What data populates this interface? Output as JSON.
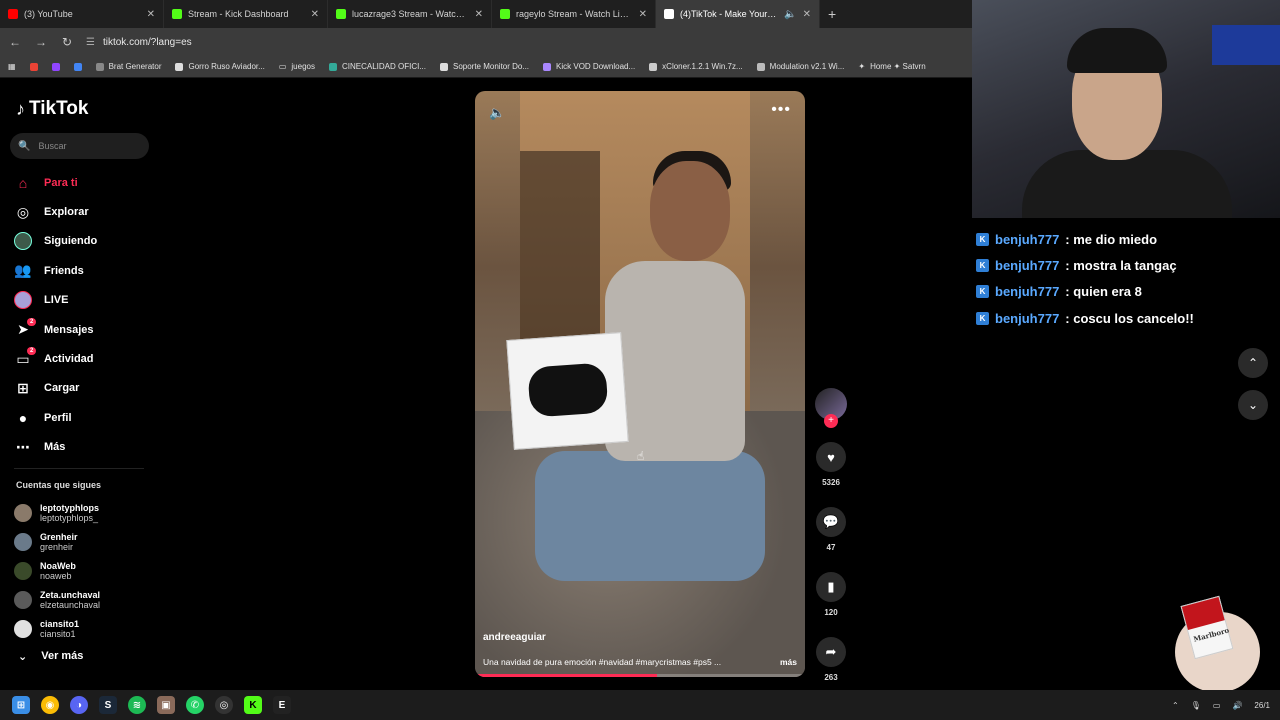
{
  "browser": {
    "tabs": [
      {
        "title": "(3) YouTube",
        "color": "#ff0000"
      },
      {
        "title": "Stream - Kick Dashboard",
        "color": "#53fc18"
      },
      {
        "title": "lucazrage3 Stream - Watch Live on",
        "color": "#53fc18"
      },
      {
        "title": "rageylo Stream - Watch Live on",
        "color": "#53fc18"
      },
      {
        "title": "(4)TikTok - Make Your Day",
        "color": "#ffffff"
      }
    ],
    "new_tab": "+",
    "url": "tiktok.com/?lang=es",
    "bookmarks": [
      "Brat Generator",
      "Gorro Ruso Aviador...",
      "juegos",
      "CINECALIDAD OFICI...",
      "Soporte Monitor Do...",
      "Kick VOD Download...",
      "xCloner.1.2.1 Win.7z...",
      "Modulation v2.1 Wi...",
      "Home ✦ Satvrn"
    ]
  },
  "tiktok": {
    "logo": "TikTok",
    "search_placeholder": "Buscar",
    "nav": [
      {
        "label": "Para ti",
        "icon": "home-icon",
        "active": true
      },
      {
        "label": "Explorar",
        "icon": "compass-icon"
      },
      {
        "label": "Siguiendo",
        "icon": "following-avatar-icon"
      },
      {
        "label": "Friends",
        "icon": "friends-icon"
      },
      {
        "label": "LIVE",
        "icon": "live-icon"
      },
      {
        "label": "Mensajes",
        "icon": "messages-icon",
        "badge": "2"
      },
      {
        "label": "Actividad",
        "icon": "activity-icon",
        "badge": "2"
      },
      {
        "label": "Cargar",
        "icon": "upload-icon"
      },
      {
        "label": "Perfil",
        "icon": "profile-icon"
      },
      {
        "label": "Más",
        "icon": "more-icon"
      }
    ],
    "following_title": "Cuentas que sigues",
    "following": [
      {
        "name": "leptotyphlops",
        "user": "leptotyphlops_",
        "color": "#8a7a6a"
      },
      {
        "name": "Grenheir",
        "user": "grenheir",
        "color": "#6a7a8a"
      },
      {
        "name": "NoaWeb",
        "user": "noaweb",
        "color": "#3a4a2a"
      },
      {
        "name": "Zeta.unchaval",
        "user": "elzetaunchaval",
        "color": "#5a5a5a"
      },
      {
        "name": "ciansito1",
        "user": "ciansito1",
        "color": "#e0e0e0"
      }
    ],
    "see_more": "Ver más",
    "video": {
      "author": "andreeaguiar",
      "description": "Una navidad de pura emoción #navidad #marycristmas #ps5 ...",
      "more": "más",
      "progress": 0.55
    },
    "actions": [
      {
        "icon": "heart-icon",
        "count": "5326"
      },
      {
        "icon": "comment-icon",
        "count": "47"
      },
      {
        "icon": "bookmark-icon",
        "count": "120"
      },
      {
        "icon": "share-icon",
        "count": "263"
      }
    ]
  },
  "chat": [
    {
      "user": "benjuh777",
      "message": ": me dio miedo"
    },
    {
      "user": "benjuh777",
      "message": ": mostra la tangaç"
    },
    {
      "user": "benjuh777",
      "message": ": quien era 8"
    },
    {
      "user": "benjuh777",
      "message": ": coscu los cancelo!!"
    }
  ],
  "overlay": {
    "pack_brand": "Marlboro"
  },
  "taskbar": {
    "clock": "26/1"
  },
  "colors": {
    "accent": "#fe2c55",
    "chat_user": "#5aa9ff",
    "kick_green": "#53fc18"
  }
}
